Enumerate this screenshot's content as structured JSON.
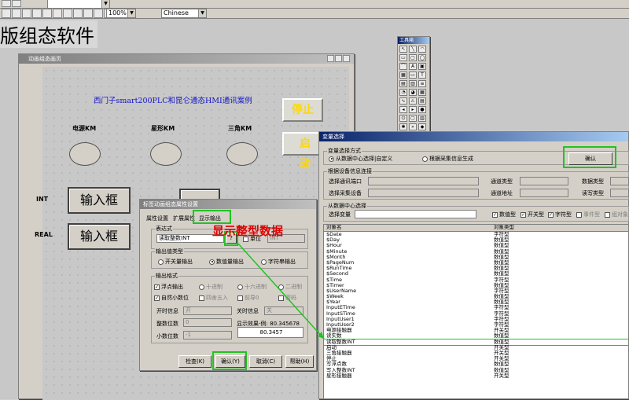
{
  "toolbar": {
    "zoom": "100%",
    "language": "Chinese"
  },
  "app_title": "版组态软件",
  "design_window": {
    "title": "动画组态画页"
  },
  "canvas": {
    "title": "西门子smart200PLC和昆仑通态HMI通讯案例",
    "lamp_labels": [
      "电源KM",
      "星形KM",
      "三角KM"
    ],
    "stop_label": "停止",
    "start_label": "启动",
    "int_label": "INT",
    "real_label": "REAL",
    "input_label": "输入框",
    "input_label2": "输入框",
    "int_label2": "INT"
  },
  "toolbox": {
    "title": "工具箱",
    "icons": [
      "pointer-icon",
      "line-icon",
      "arc-icon",
      "rect-icon",
      "roundrect-icon",
      "ellipse-icon",
      "polyline-icon",
      "text-icon",
      "picture-icon",
      "bitmap-icon",
      "button-icon",
      "label-icon",
      "input-icon",
      "combo-icon",
      "listbox-icon",
      "gauge-icon",
      "meter-icon",
      "table-icon",
      "trend-icon",
      "alarm-icon",
      "report-icon",
      "slider-icon",
      "scroll-icon",
      "lamp-icon",
      "switch-icon",
      "frame-icon",
      "chart-icon",
      "custom-icon",
      "more-icon",
      "extra-icon"
    ]
  },
  "prop_dialog": {
    "title": "标签动画组态属性设置",
    "tabs": [
      "属性设置",
      "扩展属性",
      "显示输出"
    ],
    "expr_group": "表达式",
    "expr_value": "读取整数INT",
    "q_btn": "?",
    "unit_label": "单位",
    "unit_value": "INT",
    "type_group": "输出值类型",
    "type_options": [
      "开关量输出",
      "数值量输出",
      "字符串输出"
    ],
    "format_group": "输出格式",
    "fmt_row1": [
      "浮点输出",
      "十进制",
      "十六进制",
      "二进制"
    ],
    "fmt_row2": [
      "自然小数位",
      "四舍五入",
      "前导0",
      "密码"
    ],
    "open_label": "开时信息",
    "open_value": "开",
    "close_label": "关时信息",
    "close_value": "关",
    "int_digits_label": "整数位数",
    "int_digits_value": "0",
    "dec_digits_label": "小数位数",
    "dec_digits_value": "-1",
    "effect_label": "显示效果-例:",
    "effect_example": "80.345678",
    "effect_value": "80.3457",
    "buttons": [
      "检查(K)",
      "确认(Y)",
      "取消(C)",
      "帮助(H)"
    ]
  },
  "annotation": {
    "text": "显示整型数据",
    "color": "#e00000"
  },
  "var_dialog": {
    "title": "变量选择",
    "method_group": "变量选择方式",
    "method_options": [
      "从数据中心选择|自定义",
      "根据采集信息生成"
    ],
    "confirm": "确认",
    "device_group": "根据设备信息连接",
    "device_labels": [
      "选择通讯端口",
      "通道类型",
      "数据类型",
      "选择采集设备",
      "通道地址",
      "读写类型"
    ],
    "center_group": "从数据中心选择",
    "select_var_label": "选择变量",
    "type_filters": [
      "数值型",
      "开关型",
      "字符型",
      "事件型",
      "组对象"
    ],
    "col_headers": [
      "对象名",
      "对象类型"
    ],
    "rows": [
      [
        "$Date",
        "字符型"
      ],
      [
        "$Day",
        "数值型"
      ],
      [
        "$Hour",
        "数值型"
      ],
      [
        "$Minute",
        "数值型"
      ],
      [
        "$Month",
        "数值型"
      ],
      [
        "$PageNum",
        "数值型"
      ],
      [
        "$RunTime",
        "数值型"
      ],
      [
        "$Second",
        "数值型"
      ],
      [
        "$Time",
        "字符型"
      ],
      [
        "$Timer",
        "数值型"
      ],
      [
        "$UserName",
        "字符型"
      ],
      [
        "$Week",
        "数值型"
      ],
      [
        "$Year",
        "数值型"
      ],
      [
        "InputETime",
        "字符型"
      ],
      [
        "InputSTime",
        "字符型"
      ],
      [
        "InputUser1",
        "字符型"
      ],
      [
        "InputUser2",
        "字符型"
      ],
      [
        "电源接触器",
        "开关型"
      ],
      [
        "读实数",
        "数值型"
      ],
      [
        "读取整数INT",
        "数值型"
      ],
      [
        "启动",
        "开关型"
      ],
      [
        "三角接触器",
        "开关型"
      ],
      [
        "停止",
        "开关型"
      ],
      [
        "写浮点数",
        "数值型"
      ],
      [
        "写入整数INT",
        "数值型"
      ],
      [
        "星形接触器",
        "开关型"
      ]
    ],
    "selected_row": 19
  }
}
